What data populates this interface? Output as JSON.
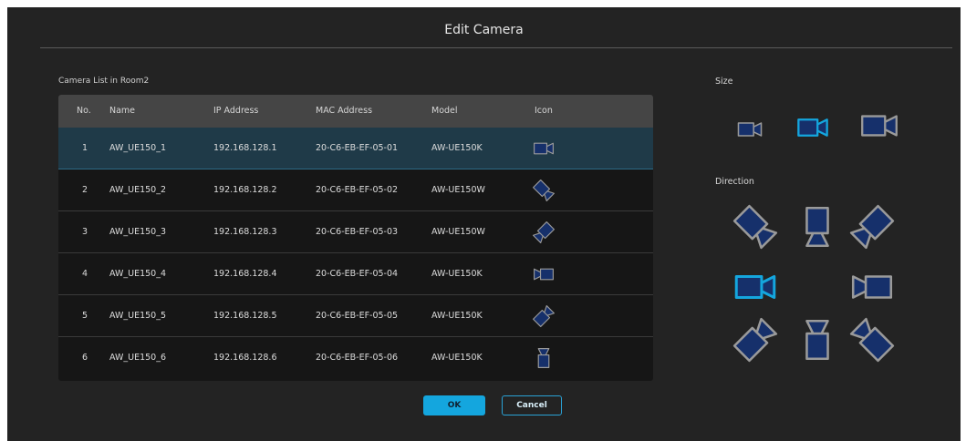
{
  "dialog": {
    "title": "Edit Camera"
  },
  "camera_list": {
    "label": "Camera List in Room2",
    "columns": {
      "no": "No.",
      "name": "Name",
      "ip": "IP Address",
      "mac": "MAC Address",
      "model": "Model",
      "icon": "Icon"
    },
    "rows": [
      {
        "no": "1",
        "name": "AW_UE150_1",
        "ip": "192.168.128.1",
        "mac": "20-C6-EB-EF-05-01",
        "model": "AW-UE150K",
        "icon": "camera-right-icon",
        "selected": true
      },
      {
        "no": "2",
        "name": "AW_UE150_2",
        "ip": "192.168.128.2",
        "mac": "20-C6-EB-EF-05-02",
        "model": "AW-UE150W",
        "icon": "camera-diagonal-down-right-icon",
        "selected": false
      },
      {
        "no": "3",
        "name": "AW_UE150_3",
        "ip": "192.168.128.3",
        "mac": "20-C6-EB-EF-05-03",
        "model": "AW-UE150W",
        "icon": "camera-diagonal-down-left-icon",
        "selected": false
      },
      {
        "no": "4",
        "name": "AW_UE150_4",
        "ip": "192.168.128.4",
        "mac": "20-C6-EB-EF-05-04",
        "model": "AW-UE150K",
        "icon": "camera-left-icon",
        "selected": false
      },
      {
        "no": "5",
        "name": "AW_UE150_5",
        "ip": "192.168.128.5",
        "mac": "20-C6-EB-EF-05-05",
        "model": "AW-UE150K",
        "icon": "camera-diagonal-up-left-icon",
        "selected": false
      },
      {
        "no": "6",
        "name": "AW_UE150_6",
        "ip": "192.168.128.6",
        "mac": "20-C6-EB-EF-05-06",
        "model": "AW-UE150K",
        "icon": "camera-up-icon",
        "selected": false
      }
    ]
  },
  "size_panel": {
    "label": "Size",
    "options": [
      "small",
      "medium",
      "large"
    ],
    "selected": "medium"
  },
  "direction_panel": {
    "label": "Direction",
    "options": [
      "down-right",
      "down",
      "down-left",
      "right",
      "left",
      "up-right",
      "up",
      "up-left"
    ],
    "selected": "right"
  },
  "buttons": {
    "ok": "OK",
    "cancel": "Cancel"
  },
  "colors": {
    "accent": "#14a6de",
    "icon_fill": "#16306b",
    "icon_stroke": "#9a9a9a",
    "selected_row": "#1f3a48"
  }
}
